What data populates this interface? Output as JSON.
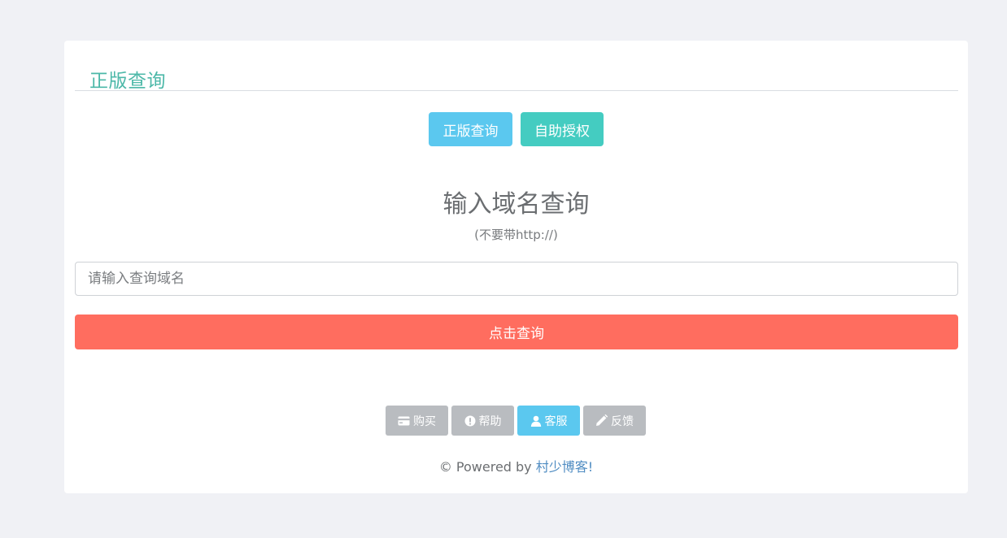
{
  "card": {
    "title": "正版查询"
  },
  "tabs": [
    {
      "label": "正版查询",
      "color": "#5bc8ef"
    },
    {
      "label": "自助授权",
      "color": "#44ccc1"
    }
  ],
  "query": {
    "headline": "输入域名查询",
    "hint": "(不要带http://)",
    "input_placeholder": "请输入查询域名",
    "input_value": "",
    "submit_label": "点击查询",
    "submit_color": "#ff6d5f"
  },
  "footer": {
    "buttons": [
      {
        "label": "购买",
        "icon": "credit-card-icon"
      },
      {
        "label": "帮助",
        "icon": "exclamation-circle-icon"
      },
      {
        "label": "客服",
        "icon": "user-icon"
      },
      {
        "label": "反馈",
        "icon": "pencil-icon"
      }
    ],
    "powered_prefix": "© Powered by ",
    "powered_brand": "村少博客!"
  },
  "colors": {
    "background": "#f0f1f5",
    "title_accent": "#4cb8a8",
    "footer_gray": "#b9bcc0",
    "footer_blue": "#5bc8ef"
  }
}
